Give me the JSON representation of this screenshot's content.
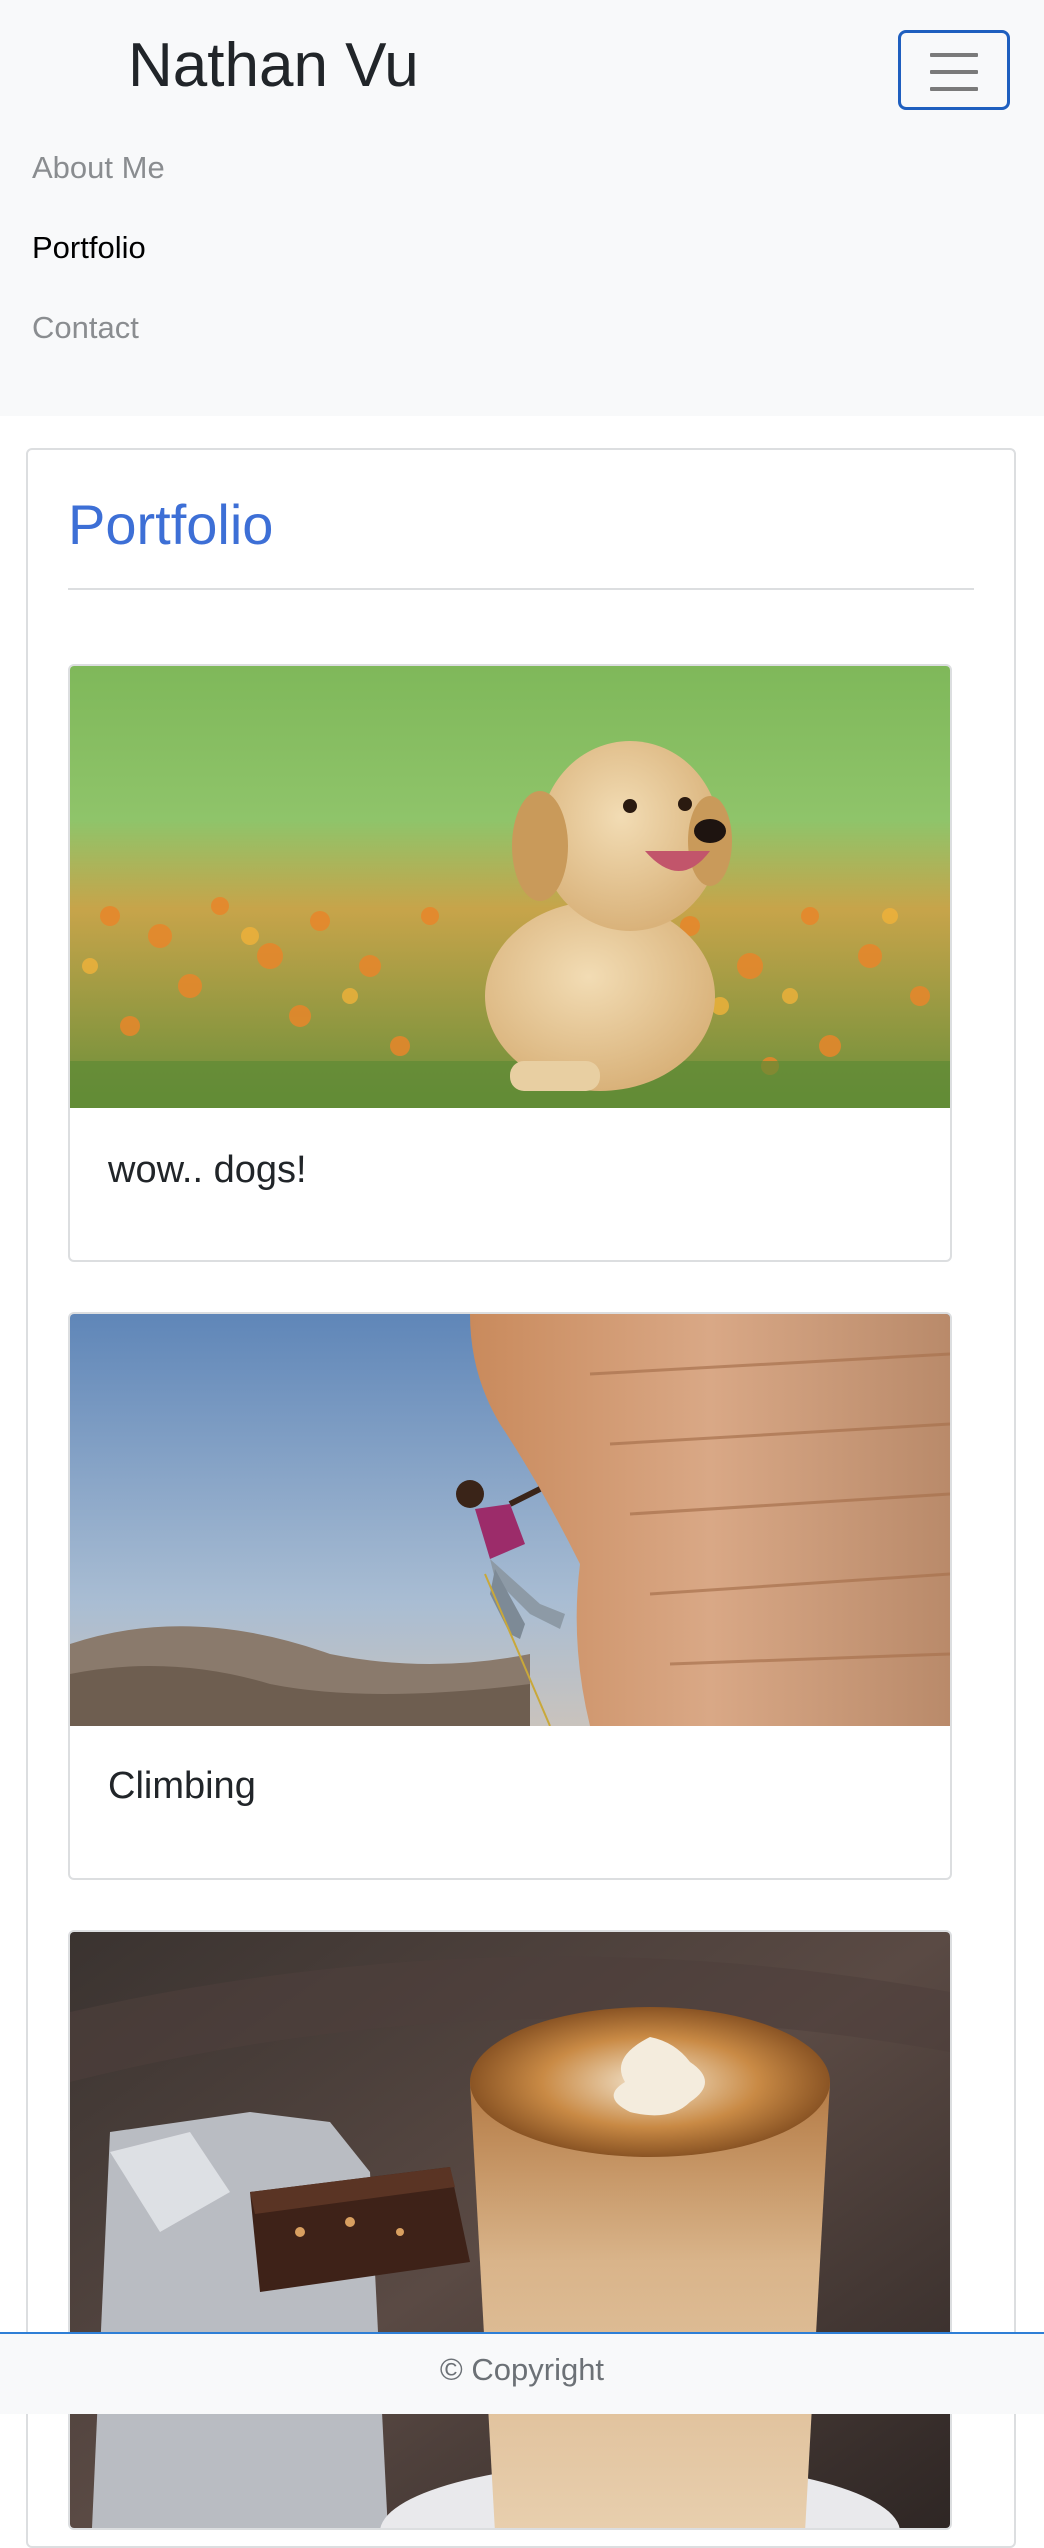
{
  "navbar": {
    "brand": "Nathan Vu",
    "toggler_icon": "hamburger-icon",
    "items": [
      {
        "label": "About Me",
        "active": false
      },
      {
        "label": "Portfolio",
        "active": true
      },
      {
        "label": "Contact",
        "active": false
      }
    ]
  },
  "main": {
    "title": "Portfolio",
    "cards": [
      {
        "title": "wow.. dogs!",
        "image": "golden-retriever-puppy-photo"
      },
      {
        "title": "Climbing",
        "image": "rock-climber-photo"
      },
      {
        "title": "",
        "image": "latte-and-brownie-photo"
      }
    ]
  },
  "footer": {
    "text": "© Copyright"
  },
  "colors": {
    "accent": "#3d6fd6",
    "navbar_bg": "#f8f9fa",
    "toggler_border": "#1f5fbf",
    "footer_border": "#2f7fd6"
  }
}
